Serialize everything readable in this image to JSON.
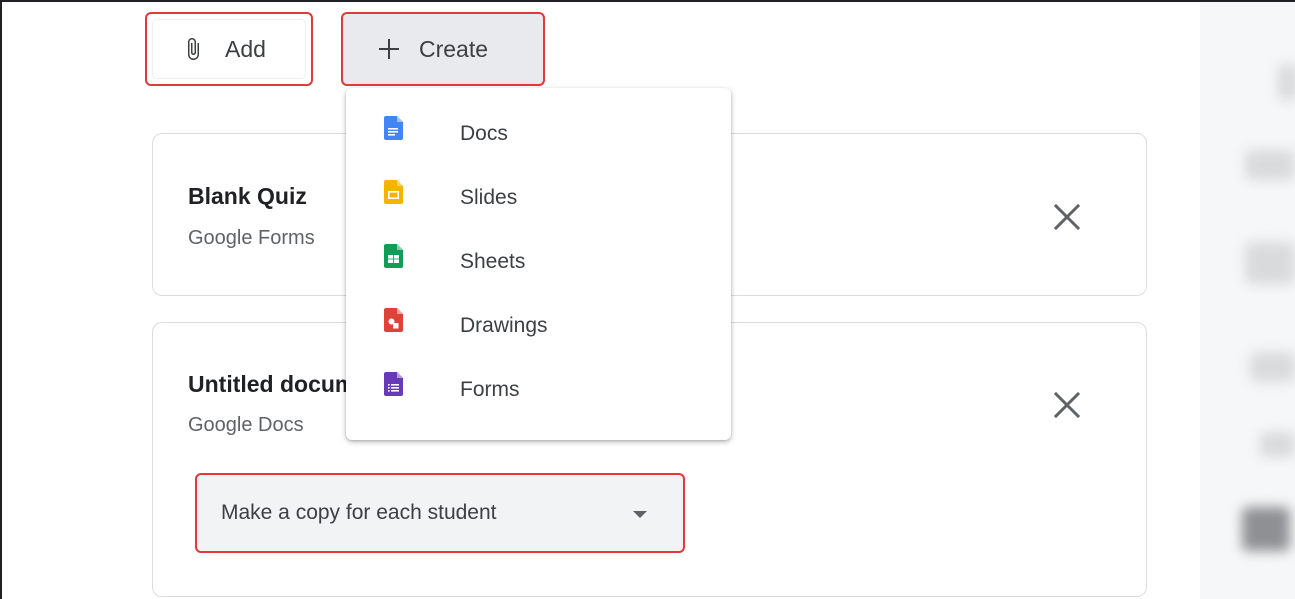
{
  "toolbar": {
    "add_label": "Add",
    "create_label": "Create"
  },
  "cards": [
    {
      "title": "Blank Quiz",
      "subtitle": "Google Forms"
    },
    {
      "title": "Untitled document",
      "subtitle": "Google Docs",
      "share_option": "Make a copy for each student"
    }
  ],
  "create_menu": {
    "items": [
      {
        "label": "Docs",
        "icon": "docs-icon",
        "color": "#4285f4"
      },
      {
        "label": "Slides",
        "icon": "slides-icon",
        "color": "#f4b400"
      },
      {
        "label": "Sheets",
        "icon": "sheets-icon",
        "color": "#0f9d58"
      },
      {
        "label": "Drawings",
        "icon": "drawings-icon",
        "color": "#db4437"
      },
      {
        "label": "Forms",
        "icon": "forms-icon",
        "color": "#673ab7"
      }
    ]
  },
  "highlight_color": "#e53935"
}
